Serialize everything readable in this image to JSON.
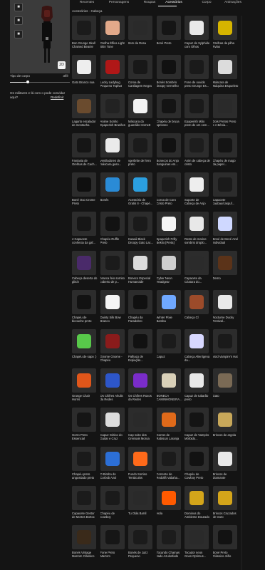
{
  "left": {
    "tools": [
      "■",
      "■",
      "■"
    ],
    "zoom_label": "2D",
    "body_type": {
      "label": "Tipo de corpo",
      "value": "3/fé",
      "level": 0.3
    },
    "note": "Os militares e-lá com o pode convidar aqui?",
    "reset_label": "Redefinir"
  },
  "tabs": [
    {
      "label": "Recentes",
      "active": false
    },
    {
      "label": "Personagens",
      "active": false
    },
    {
      "label": "Roupas",
      "active": false
    },
    {
      "label": "Acessórios",
      "active": true
    },
    {
      "label": "Corpo",
      "active": false
    },
    {
      "label": "Animações",
      "active": false
    }
  ],
  "breadcrumb": "Acessórios · Cabeça",
  "items": [
    {
      "name": "Bon Grunge Skull Chained Beanie",
      "color": "#1b1b1b"
    },
    {
      "name": "Orelha Élfica Light Skin Tone",
      "color": "#e2a98a"
    },
    {
      "name": "Item da Rosa",
      "color": "#2a2a2a"
    },
    {
      "name": "Boné Preto",
      "color": "#151515"
    },
    {
      "name": "Capuz de Sylphide com Olhos [Sincere]",
      "color": "#e9e9e9"
    },
    {
      "name": "Orelhas da pilha Rvlas",
      "color": "#d6b400"
    },
    {
      "name": "Gato Branco sua",
      "color": "#eeeeee"
    },
    {
      "name": "Lucky Ladybug Pequeno Tophat",
      "color": "#b01717"
    },
    {
      "name": "Coroa de Cartilagem Negra",
      "color": "#181818"
    },
    {
      "name": "Bonés Sombrio droopy vermelho",
      "color": "#111111"
    },
    {
      "name": "Fone de ouvido preto Grunge Es...",
      "color": "#1a1a1a"
    },
    {
      "name": "Máscara de Máquina Esqueleto",
      "color": "#dcdcdc"
    },
    {
      "name": "Lagarto escalador de montanha",
      "color": "#6a4b2e"
    },
    {
      "name": "Anime Sonho Epaperish Brasões",
      "color": "#222222"
    },
    {
      "name": "Máscara do guardião Hornett",
      "color": "#f2f2f2"
    },
    {
      "name": "Chapéu de bruxa aprisono",
      "color": "#141414"
    },
    {
      "name": "Epaperish Mão preto de um cem...",
      "color": "#1a1a1a"
    },
    {
      "name": "Dois Pretos Preto e A Bénia...",
      "color": "#2a2a2a"
    },
    {
      "name": "Fantasia de Orelhas de Cach...",
      "color": "#151515"
    },
    {
      "name": "ventiladores de máscara gaso...",
      "color": "#eaeaea"
    },
    {
      "name": "vgerbrite de ferro preto",
      "color": "#1b1b1b"
    },
    {
      "name": "Bonecos do Anjo Sanguinas em...",
      "color": "#111111"
    },
    {
      "name": "Anim de cabeça de cristo",
      "color": "#1d1d1d"
    },
    {
      "name": "Chapéu de mago da papel...",
      "color": "#141414"
    },
    {
      "name": "Boné Ouo Crome Preto",
      "color": "#0f0f0f"
    },
    {
      "name": "Bonés",
      "color": "#2a8bd6"
    },
    {
      "name": "Acessório de Gratis II - Chapé...",
      "color": "#2b9fe0"
    },
    {
      "name": "Coroa de Coro Cristo Preto",
      "color": "#1c1c1c"
    },
    {
      "name": "Suporte de Cabeça de Anjo",
      "color": "#eeeeee"
    },
    {
      "name": "Capacete caubau/caspuf...",
      "color": "#1a1a1a"
    },
    {
      "name": "4 Capacete conhecia da gaf...",
      "color": "#161616"
    },
    {
      "name": "Chapéu Ruffle Preto",
      "color": "#121212"
    },
    {
      "name": "Kawaii Black Droopy Gato Lac...",
      "color": "#1a1a1a"
    },
    {
      "name": "Epaperish Frilly Bekko [Preta]",
      "color": "#f5f5f5"
    },
    {
      "name": "Rosto de marine sombrio droplo...",
      "color": "#e8e8e8"
    },
    {
      "name": "Boné de Boné Azul Individual",
      "color": "#cfd8ff"
    },
    {
      "name": "Cabeça deserta do glitch",
      "color": "#4a2a6a"
    },
    {
      "name": "branca feio sorriso coberto de p...",
      "color": "#1b1b1b"
    },
    {
      "name": "Boneco Especial Humanoide",
      "color": "#dcdcdc"
    },
    {
      "name": "Cyber Neon Headgear",
      "color": "#cfcfcf"
    },
    {
      "name": "Capacete da Criatura do...",
      "color": "#2b2b2b"
    },
    {
      "name": "Demo",
      "color": "#5b3319"
    },
    {
      "name": "Chapéu de bicouche preto",
      "color": "#121212"
    },
    {
      "name": "Dainty Silk Bow Branco",
      "color": "#f5f5f5"
    },
    {
      "name": "Chapéu da Paradobro",
      "color": "#101010"
    },
    {
      "name": "Winter Pixie Bamba",
      "color": "#6fa8ff"
    },
    {
      "name": "Cabeça Cl",
      "color": "#9c4b2a"
    },
    {
      "name": "Nocturne Ducky Festival...",
      "color": "#e8e8e8"
    },
    {
      "name": "Chapéu de sapo :)",
      "color": "#58c94a"
    },
    {
      "name": "Gnome Gnome - Chapéu",
      "color": "#8a1b1b"
    },
    {
      "name": "Palhaço de Expiação...",
      "color": "#111111"
    },
    {
      "name": "Capuz",
      "color": "#1b1b1b"
    },
    {
      "name": "Cabeça Alienígena da...",
      "color": "#d8d8ff"
    },
    {
      "name": "Void Vampire's Hat",
      "color": "#1a1a1a"
    },
    {
      "name": "Grunge Chair Horns",
      "color": "#e0561a"
    },
    {
      "name": "Os Chifres Ahulis da Redes",
      "color": "#2d56c9"
    },
    {
      "name": "Os Chifres Roxos da Redes",
      "color": "#7a2cc9"
    },
    {
      "name": "BONECA CAMINHONEIRA...",
      "color": "#d9d0b8"
    },
    {
      "name": "Capuz de tubarão preto",
      "color": "#e8e8e8"
    },
    {
      "name": "Gato",
      "color": "#7a6a55"
    },
    {
      "name": "Gorro Preto Essencial",
      "color": "#151515"
    },
    {
      "name": "Capuz Gótico do Guitar e Cruz",
      "color": "#dddddd"
    },
    {
      "name": "Cap noite dos Gremiais Moroa",
      "color": "#2a2a2a"
    },
    {
      "name": "Gorros de Rabiscar Laranja",
      "color": "#e06a1a"
    },
    {
      "name": "Capuz de Vampiro Mórbido...",
      "color": "#141414"
    },
    {
      "name": "Brincos de argola",
      "color": "#c8a85a"
    },
    {
      "name": "Chapéu preto angustiado preto",
      "color": "#1a1a1a"
    },
    {
      "name": "O Bimbo do Corbob Azul",
      "color": "#2c6fd6"
    },
    {
      "name": "Fundo Sorriso Tentáculos",
      "color": "#ff6a1a"
    },
    {
      "name": "Corrente de Redolift Vabaha...",
      "color": "#1b1b1b"
    },
    {
      "name": "Chapéu de Cowboy Preto",
      "color": "#121212"
    },
    {
      "name": "Brincos de Diamante",
      "color": "#e8e8e8"
    },
    {
      "name": "Capacete Gestor de Mortes Bortoc",
      "color": "#1b1b1b"
    },
    {
      "name": "Chapéu de Cowboy",
      "color": "#1a1a1a"
    },
    {
      "name": "Tu Olás Barril",
      "color": "#2a2a2a"
    },
    {
      "name": "Hola",
      "color": "#ff5a00"
    },
    {
      "name": "Dominus do Ambiente Dourado",
      "color": "#d4a51a"
    },
    {
      "name": "Brincos Cruzados de Ouro",
      "color": "#d4a51a"
    },
    {
      "name": "Bonés Vintage Marrom Clássico",
      "color": "#3a2a1a"
    },
    {
      "name": "Fone Preto Marrom",
      "color": "#161616"
    },
    {
      "name": "Bonés de Jazz Pequeno",
      "color": "#1b1b1b"
    },
    {
      "name": "Tocando Chamas Jade Azulosfado",
      "color": "#1c1c1c"
    },
    {
      "name": "Tocador neon Goes Optimus...",
      "color": "#2a2a2a"
    },
    {
      "name": "Boné Preto Clássico Jéfio",
      "color": "#121212"
    }
  ]
}
